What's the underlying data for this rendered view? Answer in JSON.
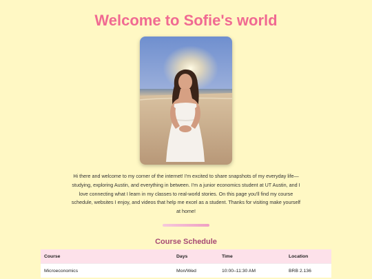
{
  "header": {
    "title": "Welcome to Sofie's world"
  },
  "intro": {
    "text": "Hi there and welcome to my corner of the internet! I'm excited to share snapshots of my everyday life—studying, exploring Austin, and everything in between. I'm a junior economics student at UT Austin, and I love connecting what I learn in my classes to real-world stories. On this page you'll find my course schedule, websites I enjoy, and videos that help me excel as a student. Thanks for visiting make yourself at home!"
  },
  "schedule": {
    "heading": "Course Schedule",
    "columns": [
      "Course",
      "Days",
      "Time",
      "Location"
    ],
    "rows": [
      [
        "Microeconomics",
        "Mon/Wed",
        "10:00–11:30 AM",
        "BRB 2.136"
      ]
    ]
  },
  "colors": {
    "background": "#fff8c4",
    "title": "#f06a92",
    "section_heading": "#a64a74",
    "table_header": "#fde1ea"
  }
}
